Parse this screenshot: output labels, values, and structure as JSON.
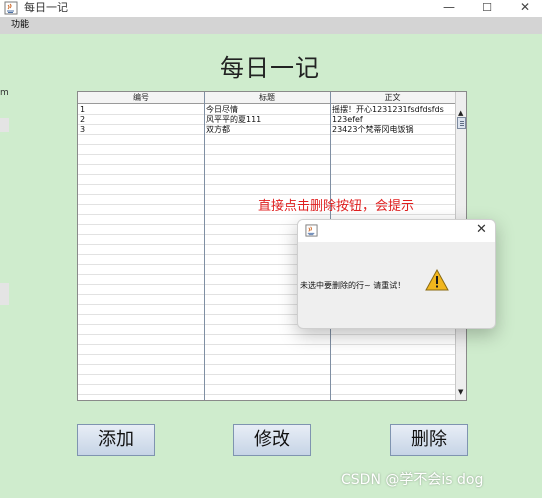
{
  "window": {
    "title": "每日一记",
    "minimize_glyph": "—",
    "maximize_glyph": "☐",
    "close_glyph": "✕",
    "icon": "java-app-icon"
  },
  "menubar": {
    "items": [
      "功能"
    ]
  },
  "edge_fragment_text": "m",
  "page_title": "每日一记",
  "table": {
    "columns": [
      "编号",
      "标题",
      "正文"
    ],
    "rows": [
      [
        "1",
        "今日尽情",
        "摇摆！开心1231231fsdfdsfds"
      ],
      [
        "2",
        "风平平的夏111",
        "123efef"
      ],
      [
        "3",
        "双方都",
        "23423个梵蒂冈电饭锅"
      ]
    ],
    "scroll_up_glyph": "▲",
    "scroll_down_glyph": "▼"
  },
  "buttons": {
    "add": "添加",
    "edit": "修改",
    "delete": "删除"
  },
  "annotation": "直接点击删除按钮，会提示",
  "dialog": {
    "message": "未选中要删除的行~ 请重试！",
    "close_glyph": "✕",
    "icon": "warning-icon",
    "accent": "#f2b61d"
  },
  "watermark": "CSDN @学不会is dog"
}
